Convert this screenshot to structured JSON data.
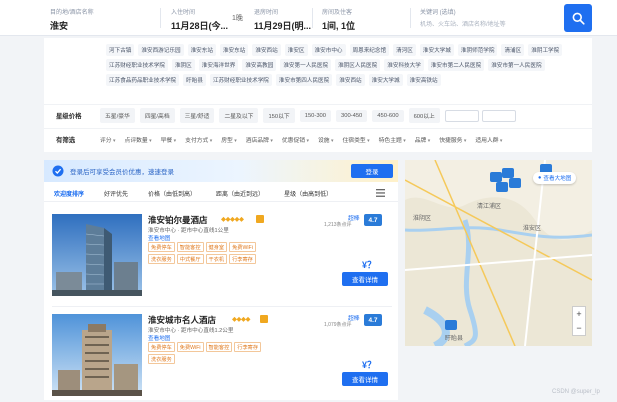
{
  "search": {
    "destination": {
      "label": "目的地/酒店名称",
      "value": "淮安"
    },
    "checkin": {
      "label": "入住时间",
      "value": "11月28日(今..."
    },
    "nights": "1晚",
    "checkout": {
      "label": "退房时间",
      "value": "11月29日(明..."
    },
    "rooms": {
      "label": "房间及住客",
      "value": "1间, 1位"
    },
    "keyword": {
      "label": "关键词 (选填)",
      "placeholder": "机场、火车站、酒店名称/地址等"
    }
  },
  "location_tags": [
    "河下古镇",
    "淮安西游记乐园",
    "淮安东站",
    "淮安东站",
    "淮安西站",
    "淮安区",
    "淮安市中心",
    "周恩来纪念馆",
    "清河区",
    "淮安大学城",
    "淮阴师范学院",
    "清浦区",
    "淮阴工学院",
    "江苏财经职业技术学院",
    "淮阴区",
    "淮安海洋世界",
    "淮安高教园",
    "淮安第一人民医院",
    "淮阴区人民医院",
    "淮安科技大学",
    "淮安市第二人民医院",
    "淮安市第一人民医院",
    "江苏食品药品职业技术学院",
    "盱眙县",
    "江苏财经职业技术学院",
    "淮安市第四人民医院",
    "淮安西站",
    "淮安大学城",
    "淮安高铁站"
  ],
  "price_filter": {
    "label": "星级价格",
    "options": [
      "五星/豪华",
      "四星/高档",
      "三星/舒适",
      "二星及以下",
      "150以下",
      "150-300",
      "300-450",
      "450-600",
      "600以上"
    ]
  },
  "more_filter": {
    "label": "有筛选",
    "options": [
      "评分",
      "点评数量",
      "早餐",
      "支付方式",
      "房型",
      "酒店品牌",
      "优惠促销",
      "设施",
      "住宿类型",
      "特色主题",
      "品牌",
      "快捷服务",
      "适用人群"
    ]
  },
  "banner": {
    "text": "登录后可享受会员价优惠，速速登录",
    "login": "登录"
  },
  "sort": [
    "欢迎度排序",
    "好评优先",
    "价格（由低到高）",
    "距离（由近到远）",
    "星级（由高到低）"
  ],
  "hotels": [
    {
      "name": "淮安铂尔曼酒店",
      "diamonds": "◆◆◆◆◆",
      "address": "淮安市中心 · 距市中心直线1公里",
      "map_link": "查看地图",
      "features": [
        "免费停车",
        "智能客控",
        "健身室",
        "免费WiFi",
        "洗衣服务",
        "中式餐厅",
        "干衣机",
        "行李寄存"
      ],
      "rating_label": "超棒",
      "reviews": "1,213条点评",
      "score": "4.7",
      "price": "¥？",
      "detail": "查看详情"
    },
    {
      "name": "淮安城市名人酒店",
      "diamonds": "◆◆◆◆",
      "address": "淮安市中心 · 距市中心直线1.2公里",
      "map_link": "查看地图",
      "features": [
        "免费停车",
        "免费WiFi",
        "智能客控",
        "行李寄存",
        "洗衣服务"
      ],
      "rating_label": "超棒",
      "reviews": "1,079条点评",
      "score": "4.7",
      "price": "¥？",
      "detail": "查看详情"
    }
  ],
  "map": {
    "big_map": "查看大地图",
    "labels": [
      "淮安区",
      "清江浦区",
      "淮阴区",
      "盱眙县"
    ],
    "zoom_in": "+",
    "zoom_out": "−"
  },
  "watermark": "CSDN @super_lp",
  "colors": {
    "accent": "#1f6ff0",
    "score_bg": "#2a7bd8",
    "feature": "#e07a1f"
  }
}
